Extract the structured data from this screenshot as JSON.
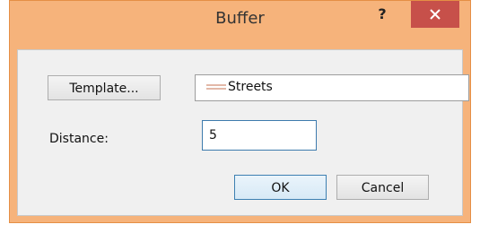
{
  "window": {
    "title": "Buffer",
    "help_label": "?",
    "accent_color": "#f6b37b",
    "close_color": "#c7504a"
  },
  "dialog": {
    "template_button_label": "Template...",
    "template_value": "Streets",
    "template_swatch_color": "#e3b8a8",
    "distance_label": "Distance:",
    "distance_value": "5",
    "ok_label": "OK",
    "cancel_label": "Cancel"
  }
}
